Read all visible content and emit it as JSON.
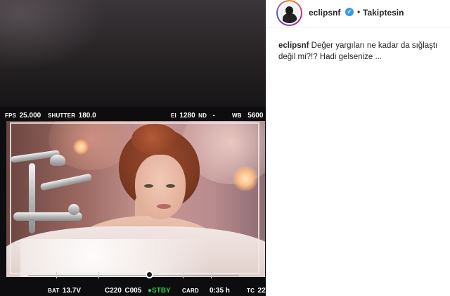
{
  "post": {
    "author": {
      "username": "eclipsnf",
      "verified_icon": "verified-badge-icon",
      "follow_separator": "•",
      "follow_status": "Takiptesin"
    },
    "caption": {
      "username": "eclipsnf",
      "text": "Değer yargıları ne kadar da sığlaştı değil mi?!? Hadi gelsenize ..."
    }
  },
  "camera_hud": {
    "top": {
      "fps_label": "FPS",
      "fps_value": "25.000",
      "shutter_label": "SHUTTER",
      "shutter_value": "180.0",
      "ei_label": "EI",
      "ei_value": "1280",
      "nd_label": "ND",
      "nd_value": "-",
      "wb_label": "WB",
      "wb_value": "5600"
    },
    "bottom": {
      "bat_label": "BAT",
      "bat_value": "13.7V",
      "clip_left": "C220",
      "clip_right": "C005",
      "stby": "STBY",
      "card_label": "CARD",
      "card_value": "0:35 h",
      "tc_label": "TC",
      "tc_value": "22"
    }
  },
  "colors": {
    "verified": "#3897f0",
    "stby_dot": "#2bd14b",
    "text_dark": "#262626"
  }
}
